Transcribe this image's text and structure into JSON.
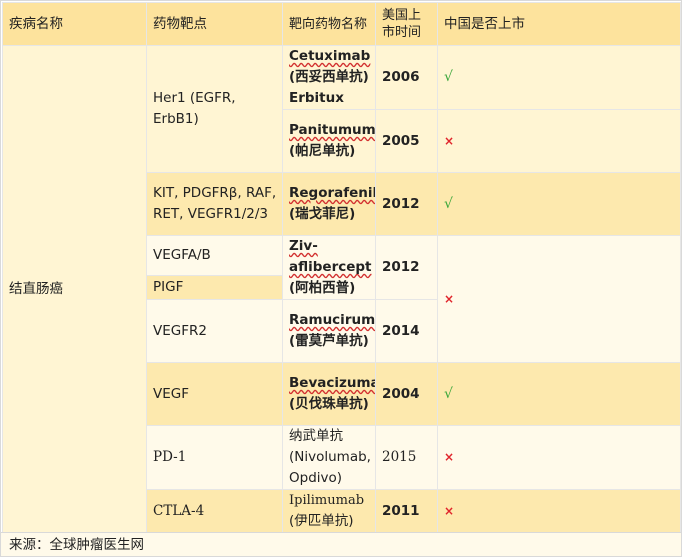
{
  "headers": {
    "disease": "疾病名称",
    "target": "药物靶点",
    "drug": "靶向药物名称",
    "us_date": "美国上市时间",
    "china": "中国是否上市"
  },
  "disease": "结直肠癌",
  "rows": [
    {
      "target": "Her1 (EGFR, ErbB1)",
      "drug_en": "Cetuximab",
      "drug_cn": "(西妥西单抗) Erbitux",
      "year": "2006",
      "china": "√"
    },
    {
      "drug_en": "Panitumumab",
      "drug_cn": "(帕尼单抗)",
      "year": "2005",
      "china": "×"
    },
    {
      "target": "KIT, PDGFRβ, RAF, RET, VEGFR1/2/3",
      "drug_en": "Regorafenib",
      "drug_cn": "(瑞戈菲尼)",
      "year": "2012",
      "china": "√"
    },
    {
      "target": "VEGFA/B",
      "drug_en": "Ziv-aflibercept",
      "drug_cn": "(阿柏西普)",
      "year": "2012",
      "china": "×"
    },
    {
      "target": "PIGF"
    },
    {
      "target": "VEGFR2",
      "drug_en": "Ramucirumab",
      "drug_cn": "(雷莫芦单抗)",
      "year": "2014"
    },
    {
      "target": "VEGF",
      "drug_en": "Bevacizumab",
      "drug_cn": "(贝伐珠单抗)",
      "year": "2004",
      "china": "√"
    },
    {
      "target": "PD-1",
      "drug_en": "纳武单抗(Nivolumab, Opdivo)",
      "year": "2015",
      "china": "×"
    },
    {
      "target": "CTLA-4",
      "drug_en": "Ipilimumab",
      "drug_cn": "(伊匹单抗)",
      "year": "2011",
      "china": "×"
    }
  ],
  "source": "来源：全球肿瘤医生网",
  "colors": {
    "header": "#fde39d",
    "band": "#fff5d3",
    "check": "#3aa63a",
    "cross": "#e0242b"
  }
}
